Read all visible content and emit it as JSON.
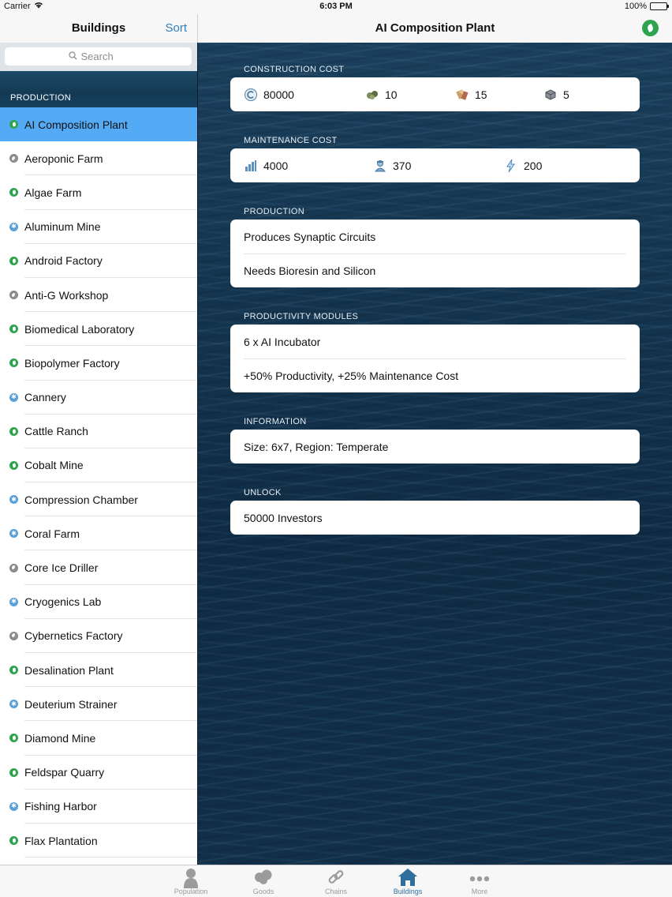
{
  "status_bar": {
    "carrier": "Carrier",
    "time": "6:03 PM",
    "battery": "100%"
  },
  "master": {
    "title": "Buildings",
    "sort_label": "Sort",
    "search_placeholder": "Search",
    "section_header": "PRODUCTION",
    "items": [
      {
        "label": "AI Composition Plant",
        "region": "green",
        "selected": true
      },
      {
        "label": "Aeroponic Farm",
        "region": "grey"
      },
      {
        "label": "Algae Farm",
        "region": "green"
      },
      {
        "label": "Aluminum Mine",
        "region": "blue"
      },
      {
        "label": "Android Factory",
        "region": "green"
      },
      {
        "label": "Anti-G Workshop",
        "region": "grey"
      },
      {
        "label": "Biomedical Laboratory",
        "region": "green"
      },
      {
        "label": "Biopolymer Factory",
        "region": "green"
      },
      {
        "label": "Cannery",
        "region": "blue"
      },
      {
        "label": "Cattle Ranch",
        "region": "green"
      },
      {
        "label": "Cobalt Mine",
        "region": "green"
      },
      {
        "label": "Compression Chamber",
        "region": "blue"
      },
      {
        "label": "Coral Farm",
        "region": "blue"
      },
      {
        "label": "Core Ice Driller",
        "region": "grey"
      },
      {
        "label": "Cryogenics Lab",
        "region": "blue"
      },
      {
        "label": "Cybernetics Factory",
        "region": "grey"
      },
      {
        "label": "Desalination Plant",
        "region": "green"
      },
      {
        "label": "Deuterium Strainer",
        "region": "blue"
      },
      {
        "label": "Diamond Mine",
        "region": "green"
      },
      {
        "label": "Feldspar Quarry",
        "region": "green"
      },
      {
        "label": "Fishing Harbor",
        "region": "blue"
      },
      {
        "label": "Flax Plantation",
        "region": "green"
      }
    ]
  },
  "detail": {
    "title": "AI Composition Plant",
    "construction_cost": {
      "header": "CONSTRUCTION COST",
      "credits": "80000",
      "tools": "10",
      "building_modules": "15",
      "steel": "5"
    },
    "maintenance_cost": {
      "header": "MAINTENANCE COST",
      "balance": "4000",
      "workforce": "370",
      "energy": "200"
    },
    "production": {
      "header": "PRODUCTION",
      "produces": "Produces Synaptic Circuits",
      "needs": "Needs Bioresin and Silicon"
    },
    "productivity_modules": {
      "header": "PRODUCTIVITY MODULES",
      "module": "6 x AI Incubator",
      "effect": "+50% Productivity, +25% Maintenance Cost"
    },
    "information": {
      "header": "INFORMATION",
      "text": "Size: 6x7, Region: Temperate"
    },
    "unlock": {
      "header": "UNLOCK",
      "text": "50000 Investors"
    }
  },
  "tabbar": {
    "tabs": [
      {
        "label": "Population",
        "icon": "person-icon"
      },
      {
        "label": "Goods",
        "icon": "goods-icon"
      },
      {
        "label": "Chains",
        "icon": "chain-icon"
      },
      {
        "label": "Buildings",
        "icon": "house-icon",
        "active": true
      },
      {
        "label": "More",
        "icon": "more-dots-icon"
      }
    ]
  },
  "colors": {
    "accent": "#2f7fbd",
    "selection": "#55aaf5",
    "temperate": "#2ea44f",
    "arctic": "#5a9fd8",
    "moon": "#8a8a8a"
  }
}
